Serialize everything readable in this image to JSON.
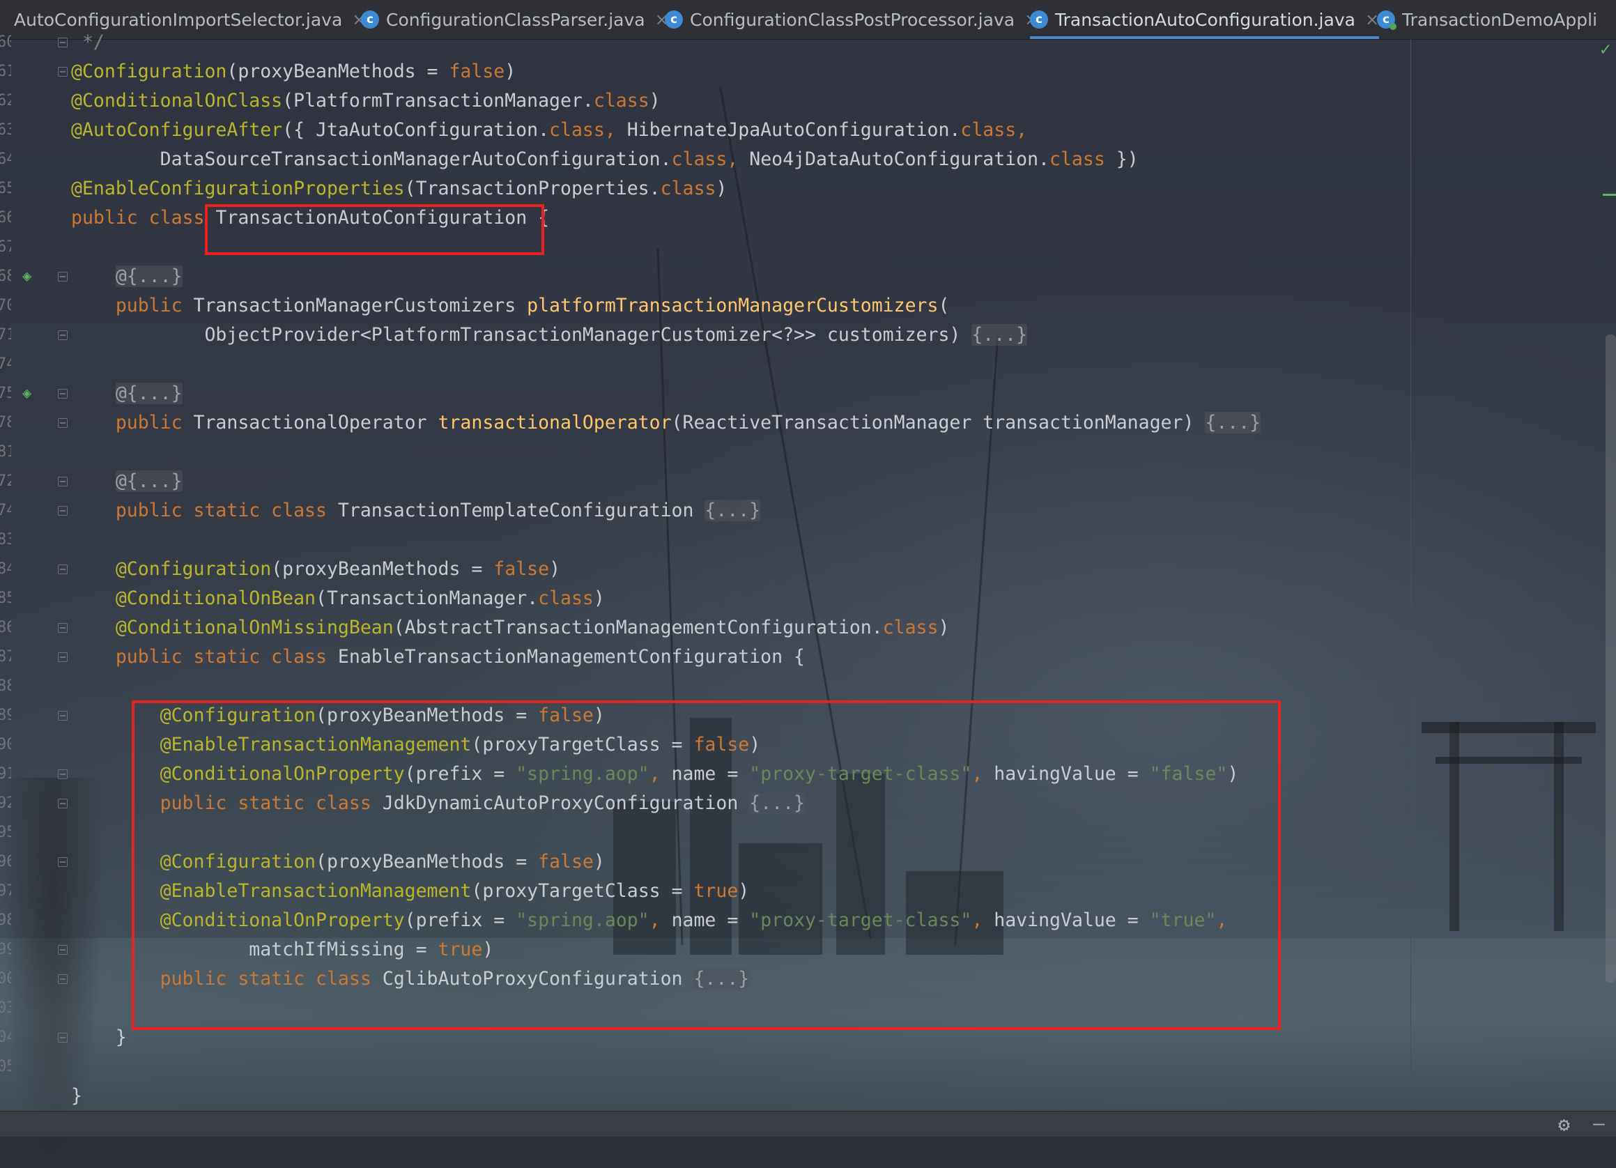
{
  "tabs": [
    {
      "label": "AutoConfigurationImportSelector.java",
      "icon": "class-icon",
      "active": false
    },
    {
      "label": "ConfigurationClassParser.java",
      "icon": "class-icon",
      "active": false
    },
    {
      "label": "ConfigurationClassPostProcessor.java",
      "icon": "class-icon",
      "active": false
    },
    {
      "label": "TransactionAutoConfiguration.java",
      "icon": "class-icon",
      "active": true
    },
    {
      "label": "TransactionDemoAppli",
      "icon": "spring-boot-class-icon",
      "active": false
    }
  ],
  "close_glyph": "×",
  "line_numbers": [
    "60",
    "61",
    "62",
    "63",
    "64",
    "65",
    "66",
    "67",
    "68",
    "70",
    "71",
    "74",
    "75",
    "78",
    "81",
    "72",
    "74",
    "83",
    "84",
    "85",
    "86",
    "87",
    "88",
    "89",
    "90",
    "91",
    "92",
    "95",
    "96",
    "97",
    "98",
    "99",
    "00",
    "03",
    "04",
    "05"
  ],
  "code_lines": [
    {
      "parts": [
        {
          "t": " */",
          "c": "cm"
        }
      ]
    },
    {
      "parts": [
        {
          "t": "@Configuration",
          "c": "ann"
        },
        {
          "t": "(proxyBeanMethods = "
        },
        {
          "t": "false",
          "c": "kw"
        },
        {
          "t": ")"
        }
      ]
    },
    {
      "parts": [
        {
          "t": "@ConditionalOnClass",
          "c": "ann"
        },
        {
          "t": "(PlatformTransactionManager."
        },
        {
          "t": "class",
          "c": "kw"
        },
        {
          "t": ")"
        }
      ]
    },
    {
      "parts": [
        {
          "t": "@AutoConfigureAfter",
          "c": "ann"
        },
        {
          "t": "({ JtaAutoConfiguration."
        },
        {
          "t": "class, ",
          "c": "kw"
        },
        {
          "t": "HibernateJpaAutoConfiguration."
        },
        {
          "t": "class,",
          "c": "kw"
        }
      ]
    },
    {
      "parts": [
        {
          "t": "        DataSourceTransactionManagerAutoConfiguration."
        },
        {
          "t": "class, ",
          "c": "kw"
        },
        {
          "t": "Neo4jDataAutoConfiguration."
        },
        {
          "t": "class",
          "c": "kw"
        },
        {
          "t": " })"
        }
      ]
    },
    {
      "parts": [
        {
          "t": "@EnableConfigurationProperties",
          "c": "ann"
        },
        {
          "t": "(TransactionProperties."
        },
        {
          "t": "class",
          "c": "kw"
        },
        {
          "t": ")"
        }
      ]
    },
    {
      "parts": [
        {
          "t": "public class ",
          "c": "kw"
        },
        {
          "t": "TransactionAutoConfiguration "
        },
        {
          "t": "{"
        }
      ]
    },
    {
      "parts": [
        {
          "t": ""
        }
      ]
    },
    {
      "parts": [
        {
          "t": "    "
        },
        {
          "t": "@{...}",
          "c": "fd"
        }
      ]
    },
    {
      "parts": [
        {
          "t": "    public ",
          "c": "kw"
        },
        {
          "t": "TransactionManagerCustomizers "
        },
        {
          "t": "platformTransactionManagerCustomizers",
          "c": "fn"
        },
        {
          "t": "("
        }
      ]
    },
    {
      "parts": [
        {
          "t": "            ObjectProvider<PlatformTransactionManagerCustomizer<?>> customizers) "
        },
        {
          "t": "{...}",
          "c": "fd"
        }
      ]
    },
    {
      "parts": [
        {
          "t": ""
        }
      ]
    },
    {
      "parts": [
        {
          "t": "    "
        },
        {
          "t": "@{...}",
          "c": "fd"
        }
      ]
    },
    {
      "parts": [
        {
          "t": "    public ",
          "c": "kw"
        },
        {
          "t": "TransactionalOperator "
        },
        {
          "t": "transactionalOperator",
          "c": "fn"
        },
        {
          "t": "(ReactiveTransactionManager transactionManager) "
        },
        {
          "t": "{...}",
          "c": "fd"
        }
      ]
    },
    {
      "parts": [
        {
          "t": ""
        }
      ]
    },
    {
      "parts": [
        {
          "t": "    "
        },
        {
          "t": "@{...}",
          "c": "fd"
        }
      ]
    },
    {
      "parts": [
        {
          "t": "    public static class ",
          "c": "kw"
        },
        {
          "t": "TransactionTemplateConfiguration "
        },
        {
          "t": "{...}",
          "c": "fd"
        }
      ]
    },
    {
      "parts": [
        {
          "t": ""
        }
      ]
    },
    {
      "parts": [
        {
          "t": "    "
        },
        {
          "t": "@Configuration",
          "c": "ann"
        },
        {
          "t": "(proxyBeanMethods = "
        },
        {
          "t": "false",
          "c": "kw"
        },
        {
          "t": ")"
        }
      ]
    },
    {
      "parts": [
        {
          "t": "    "
        },
        {
          "t": "@ConditionalOnBean",
          "c": "ann"
        },
        {
          "t": "(TransactionManager."
        },
        {
          "t": "class",
          "c": "kw"
        },
        {
          "t": ")"
        }
      ]
    },
    {
      "parts": [
        {
          "t": "    "
        },
        {
          "t": "@ConditionalOnMissingBean",
          "c": "ann"
        },
        {
          "t": "(AbstractTransactionManagementConfiguration."
        },
        {
          "t": "class",
          "c": "kw"
        },
        {
          "t": ")"
        }
      ]
    },
    {
      "parts": [
        {
          "t": "    public static class ",
          "c": "kw"
        },
        {
          "t": "EnableTransactionManagementConfiguration {"
        }
      ]
    },
    {
      "parts": [
        {
          "t": ""
        }
      ]
    },
    {
      "parts": [
        {
          "t": "        "
        },
        {
          "t": "@Configuration",
          "c": "ann"
        },
        {
          "t": "(proxyBeanMethods = "
        },
        {
          "t": "false",
          "c": "kw"
        },
        {
          "t": ")"
        }
      ]
    },
    {
      "parts": [
        {
          "t": "        "
        },
        {
          "t": "@EnableTransactionManagement",
          "c": "ann"
        },
        {
          "t": "(proxyTargetClass = "
        },
        {
          "t": "false",
          "c": "kw"
        },
        {
          "t": ")"
        }
      ]
    },
    {
      "parts": [
        {
          "t": "        "
        },
        {
          "t": "@ConditionalOnProperty",
          "c": "ann"
        },
        {
          "t": "(prefix = "
        },
        {
          "t": "\"spring.aop\"",
          "c": "str"
        },
        {
          "t": ", ",
          "c": "kw"
        },
        {
          "t": "name = "
        },
        {
          "t": "\"proxy-target-class\"",
          "c": "str"
        },
        {
          "t": ", ",
          "c": "kw"
        },
        {
          "t": "havingValue = "
        },
        {
          "t": "\"false\"",
          "c": "str"
        },
        {
          "t": ")"
        }
      ]
    },
    {
      "parts": [
        {
          "t": "        public static class ",
          "c": "kw"
        },
        {
          "t": "JdkDynamicAutoProxyConfiguration "
        },
        {
          "t": "{...}",
          "c": "fd"
        }
      ]
    },
    {
      "parts": [
        {
          "t": ""
        }
      ]
    },
    {
      "parts": [
        {
          "t": "        "
        },
        {
          "t": "@Configuration",
          "c": "ann"
        },
        {
          "t": "(proxyBeanMethods = "
        },
        {
          "t": "false",
          "c": "kw"
        },
        {
          "t": ")"
        }
      ]
    },
    {
      "parts": [
        {
          "t": "        "
        },
        {
          "t": "@EnableTransactionManagement",
          "c": "ann"
        },
        {
          "t": "(proxyTargetClass = "
        },
        {
          "t": "true",
          "c": "kw"
        },
        {
          "t": ")"
        }
      ]
    },
    {
      "parts": [
        {
          "t": "        "
        },
        {
          "t": "@ConditionalOnProperty",
          "c": "ann"
        },
        {
          "t": "(prefix = "
        },
        {
          "t": "\"spring.aop\"",
          "c": "str"
        },
        {
          "t": ", ",
          "c": "kw"
        },
        {
          "t": "name = "
        },
        {
          "t": "\"proxy-target-class\"",
          "c": "str"
        },
        {
          "t": ", ",
          "c": "kw"
        },
        {
          "t": "havingValue = "
        },
        {
          "t": "\"true\"",
          "c": "str"
        },
        {
          "t": ",",
          "c": "kw"
        }
      ]
    },
    {
      "parts": [
        {
          "t": "                matchIfMissing = "
        },
        {
          "t": "true",
          "c": "kw"
        },
        {
          "t": ")"
        }
      ]
    },
    {
      "parts": [
        {
          "t": "        public static class ",
          "c": "kw"
        },
        {
          "t": "CglibAutoProxyConfiguration "
        },
        {
          "t": "{...}",
          "c": "fd"
        }
      ]
    },
    {
      "parts": [
        {
          "t": ""
        }
      ]
    },
    {
      "parts": [
        {
          "t": "    }"
        }
      ]
    },
    {
      "parts": [
        {
          "t": ""
        }
      ]
    },
    {
      "parts": [
        {
          "t": "}"
        }
      ]
    }
  ],
  "colors": {
    "annotation": "#bbb529",
    "keyword": "#cc7832",
    "string": "#6a8759",
    "method": "#ffc66d",
    "highlight": "#e8231e"
  },
  "status_icons": [
    "gear-icon",
    "hide-icon"
  ],
  "status_glyphs": {
    "gear": "⚙",
    "hide": "—"
  }
}
